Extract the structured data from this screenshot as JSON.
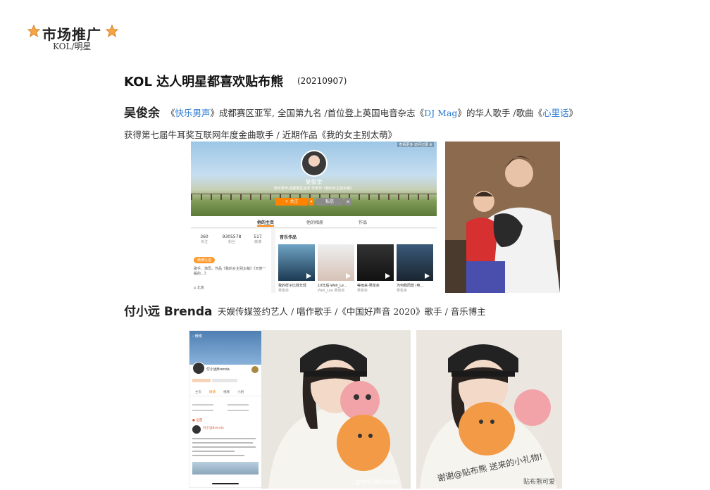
{
  "header": {
    "title": "市场推广",
    "subtitle": "KOL/明星"
  },
  "section": {
    "title": "KOL 达人明星都喜欢贴布熊",
    "date": "(20210907)"
  },
  "person1": {
    "name": "吴俊余",
    "line1": {
      "a": "《",
      "link1": "快乐男声",
      "b": "》成都赛区亚军, 全国第九名 /首位登上英国电音杂志《",
      "link2": "DJ Mag",
      "c": "》的华人歌手 /歌曲《",
      "link3": "心里话",
      "d": "》"
    },
    "line2": "获得第七届牛耳奖互联网年度金曲歌手 / 近期作品《我的女主别太萌》"
  },
  "person2": {
    "name": "付小远 Brenda",
    "desc": "天娱传媒签约艺人 / 唱作歌手 /《中国好声音 2020》歌手 / 音乐博主"
  },
  "weibo1": {
    "top_right": "查看更多 访问记录 ⚙",
    "username": "吴俊余",
    "bio": "快乐男声·成都赛区亚军 代表作《我的女主别太萌》",
    "follow_btn": "+ 关注",
    "message_btn": "私信",
    "tabs": [
      "他的主页",
      "他的相册",
      "作品"
    ],
    "stats": [
      {
        "num": "360",
        "label": "关注"
      },
      {
        "num": "9305578",
        "label": "粉丝"
      },
      {
        "num": "517",
        "label": "微博"
      }
    ],
    "badge": "微博认证",
    "intro": "歌手、演员。作品《我的女主别太萌》《天使一般的…》",
    "music_title": "音乐作品",
    "albums": [
      {
        "title": "我的样子比我年轻",
        "artist": "吴俊余"
      },
      {
        "title": "10年后-Well_Le…",
        "artist": "Well_Lee 吴俊余"
      },
      {
        "title": "等雨来-吴俊余",
        "artist": "吴俊余"
      },
      {
        "title": "为何我而尊 (电…",
        "artist": "吴俊余"
      }
    ],
    "location": "北京"
  },
  "phone": {
    "header": "付小远Brenda",
    "tabs": [
      "主页",
      "微博",
      "视频",
      "小组"
    ],
    "post_author": "付小远Brenda"
  },
  "photo2": {
    "watermark": "@付小远Brenda"
  },
  "photo3": {
    "handwriting": "谢谢@贴布熊 送来的小礼物!",
    "stamp": "贴布熊可爱"
  },
  "colors": {
    "link": "#2a7bd2",
    "follow": "#ff8200",
    "star": "#f5a443"
  }
}
